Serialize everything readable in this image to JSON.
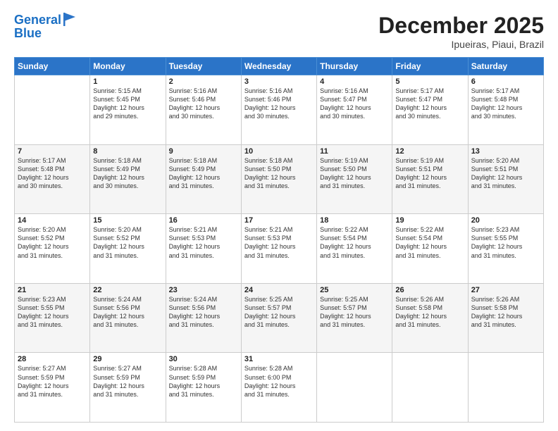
{
  "logo": {
    "line1": "General",
    "line2": "Blue"
  },
  "title": "December 2025",
  "subtitle": "Ipueiras, Piaui, Brazil",
  "weekdays": [
    "Sunday",
    "Monday",
    "Tuesday",
    "Wednesday",
    "Thursday",
    "Friday",
    "Saturday"
  ],
  "weeks": [
    [
      {
        "day": "",
        "text": ""
      },
      {
        "day": "1",
        "text": "Sunrise: 5:15 AM\nSunset: 5:45 PM\nDaylight: 12 hours\nand 29 minutes."
      },
      {
        "day": "2",
        "text": "Sunrise: 5:16 AM\nSunset: 5:46 PM\nDaylight: 12 hours\nand 30 minutes."
      },
      {
        "day": "3",
        "text": "Sunrise: 5:16 AM\nSunset: 5:46 PM\nDaylight: 12 hours\nand 30 minutes."
      },
      {
        "day": "4",
        "text": "Sunrise: 5:16 AM\nSunset: 5:47 PM\nDaylight: 12 hours\nand 30 minutes."
      },
      {
        "day": "5",
        "text": "Sunrise: 5:17 AM\nSunset: 5:47 PM\nDaylight: 12 hours\nand 30 minutes."
      },
      {
        "day": "6",
        "text": "Sunrise: 5:17 AM\nSunset: 5:48 PM\nDaylight: 12 hours\nand 30 minutes."
      }
    ],
    [
      {
        "day": "7",
        "text": "Sunrise: 5:17 AM\nSunset: 5:48 PM\nDaylight: 12 hours\nand 30 minutes."
      },
      {
        "day": "8",
        "text": "Sunrise: 5:18 AM\nSunset: 5:49 PM\nDaylight: 12 hours\nand 30 minutes."
      },
      {
        "day": "9",
        "text": "Sunrise: 5:18 AM\nSunset: 5:49 PM\nDaylight: 12 hours\nand 31 minutes."
      },
      {
        "day": "10",
        "text": "Sunrise: 5:18 AM\nSunset: 5:50 PM\nDaylight: 12 hours\nand 31 minutes."
      },
      {
        "day": "11",
        "text": "Sunrise: 5:19 AM\nSunset: 5:50 PM\nDaylight: 12 hours\nand 31 minutes."
      },
      {
        "day": "12",
        "text": "Sunrise: 5:19 AM\nSunset: 5:51 PM\nDaylight: 12 hours\nand 31 minutes."
      },
      {
        "day": "13",
        "text": "Sunrise: 5:20 AM\nSunset: 5:51 PM\nDaylight: 12 hours\nand 31 minutes."
      }
    ],
    [
      {
        "day": "14",
        "text": "Sunrise: 5:20 AM\nSunset: 5:52 PM\nDaylight: 12 hours\nand 31 minutes."
      },
      {
        "day": "15",
        "text": "Sunrise: 5:20 AM\nSunset: 5:52 PM\nDaylight: 12 hours\nand 31 minutes."
      },
      {
        "day": "16",
        "text": "Sunrise: 5:21 AM\nSunset: 5:53 PM\nDaylight: 12 hours\nand 31 minutes."
      },
      {
        "day": "17",
        "text": "Sunrise: 5:21 AM\nSunset: 5:53 PM\nDaylight: 12 hours\nand 31 minutes."
      },
      {
        "day": "18",
        "text": "Sunrise: 5:22 AM\nSunset: 5:54 PM\nDaylight: 12 hours\nand 31 minutes."
      },
      {
        "day": "19",
        "text": "Sunrise: 5:22 AM\nSunset: 5:54 PM\nDaylight: 12 hours\nand 31 minutes."
      },
      {
        "day": "20",
        "text": "Sunrise: 5:23 AM\nSunset: 5:55 PM\nDaylight: 12 hours\nand 31 minutes."
      }
    ],
    [
      {
        "day": "21",
        "text": "Sunrise: 5:23 AM\nSunset: 5:55 PM\nDaylight: 12 hours\nand 31 minutes."
      },
      {
        "day": "22",
        "text": "Sunrise: 5:24 AM\nSunset: 5:56 PM\nDaylight: 12 hours\nand 31 minutes."
      },
      {
        "day": "23",
        "text": "Sunrise: 5:24 AM\nSunset: 5:56 PM\nDaylight: 12 hours\nand 31 minutes."
      },
      {
        "day": "24",
        "text": "Sunrise: 5:25 AM\nSunset: 5:57 PM\nDaylight: 12 hours\nand 31 minutes."
      },
      {
        "day": "25",
        "text": "Sunrise: 5:25 AM\nSunset: 5:57 PM\nDaylight: 12 hours\nand 31 minutes."
      },
      {
        "day": "26",
        "text": "Sunrise: 5:26 AM\nSunset: 5:58 PM\nDaylight: 12 hours\nand 31 minutes."
      },
      {
        "day": "27",
        "text": "Sunrise: 5:26 AM\nSunset: 5:58 PM\nDaylight: 12 hours\nand 31 minutes."
      }
    ],
    [
      {
        "day": "28",
        "text": "Sunrise: 5:27 AM\nSunset: 5:59 PM\nDaylight: 12 hours\nand 31 minutes."
      },
      {
        "day": "29",
        "text": "Sunrise: 5:27 AM\nSunset: 5:59 PM\nDaylight: 12 hours\nand 31 minutes."
      },
      {
        "day": "30",
        "text": "Sunrise: 5:28 AM\nSunset: 5:59 PM\nDaylight: 12 hours\nand 31 minutes."
      },
      {
        "day": "31",
        "text": "Sunrise: 5:28 AM\nSunset: 6:00 PM\nDaylight: 12 hours\nand 31 minutes."
      },
      {
        "day": "",
        "text": ""
      },
      {
        "day": "",
        "text": ""
      },
      {
        "day": "",
        "text": ""
      }
    ]
  ]
}
